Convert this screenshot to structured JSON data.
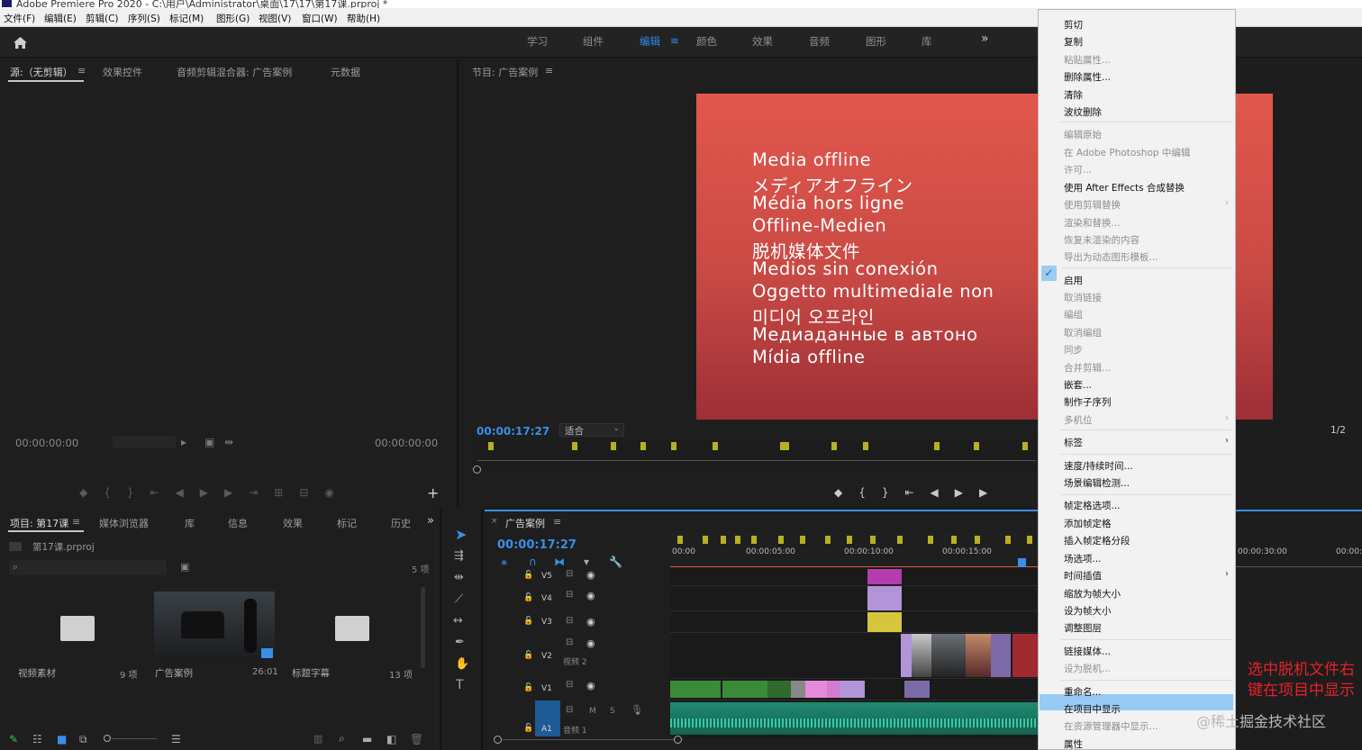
{
  "window": {
    "title": "Adobe Premiere Pro 2020 - C:\\用户\\Administrator\\桌面\\17\\17\\第17课.prproj *"
  },
  "menubar": [
    "文件(F)",
    "编辑(E)",
    "剪辑(C)",
    "序列(S)",
    "标记(M)",
    "图形(G)",
    "视图(V)",
    "窗口(W)",
    "帮助(H)"
  ],
  "workspaces": {
    "items": [
      "学习",
      "组件",
      "编辑",
      "颜色",
      "效果",
      "音频",
      "图形",
      "库"
    ],
    "active": "编辑",
    "more": "»"
  },
  "source_panel": {
    "tabs": [
      "源:（无剪辑）",
      "效果控件",
      "音频剪辑混合器: 广告案例",
      "元数据"
    ],
    "timecode_in": "00:00:00:00",
    "timecode_out": "00:00:00:00"
  },
  "program_panel": {
    "title": "节目: 广告案例",
    "timecode": "00:00:17:27",
    "fit": "适合",
    "resolution": "1/2",
    "offline_lines": [
      "Media offline",
      "メディアオフライン",
      "Média hors ligne",
      "Offline-Medien",
      "脱机媒体文件",
      "Medios sin conexión",
      "Oggetto multimediale non",
      "미디어 오프라인",
      "Медиаданные в автоно",
      "Mídia offline"
    ]
  },
  "project_panel": {
    "tabs": [
      "项目: 第17课",
      "媒体浏览器",
      "库",
      "信息",
      "效果",
      "标记",
      "历史"
    ],
    "file": "第17课.prproj",
    "count": "5 项",
    "bins": [
      {
        "name": "视频素材",
        "meta": "9 项"
      },
      {
        "name": "广告案例",
        "meta": "26:01"
      },
      {
        "name": "标题字幕",
        "meta": "13 项"
      }
    ]
  },
  "timeline": {
    "title": "广告案例",
    "timecode": "00:00:17:27",
    "ruler": [
      "00:00",
      "00:00:05:00",
      "00:00:10:00",
      "00:00:15:00",
      "00:00:30:00",
      "00:00:3"
    ],
    "tracks": [
      {
        "id": "V5",
        "label": ""
      },
      {
        "id": "V4",
        "label": ""
      },
      {
        "id": "V3",
        "label": ""
      },
      {
        "id": "V2",
        "label": "视频 2"
      },
      {
        "id": "V1",
        "label": ""
      },
      {
        "id": "A1",
        "label": "音频 1"
      }
    ],
    "audio_btns": [
      "M",
      "S"
    ]
  },
  "context_menu": {
    "items": [
      {
        "label": "剪切",
        "enabled": true
      },
      {
        "label": "复制",
        "enabled": true
      },
      {
        "label": "粘贴属性...",
        "enabled": false
      },
      {
        "label": "删除属性...",
        "enabled": true
      },
      {
        "label": "清除",
        "enabled": true
      },
      {
        "label": "波纹删除",
        "enabled": true
      },
      {
        "label": "编辑原始",
        "enabled": false
      },
      {
        "label": "在 Adobe Photoshop 中编辑",
        "enabled": false
      },
      {
        "label": "许可...",
        "enabled": false
      },
      {
        "label": "使用 After Effects 合成替换",
        "enabled": true
      },
      {
        "label": "使用剪辑替换",
        "enabled": false
      },
      {
        "label": "渲染和替换...",
        "enabled": false
      },
      {
        "label": "恢复未渲染的内容",
        "enabled": false
      },
      {
        "label": "导出为动态图形模板...",
        "enabled": false
      },
      {
        "label": "启用",
        "enabled": true
      },
      {
        "label": "取消链接",
        "enabled": false
      },
      {
        "label": "编组",
        "enabled": false
      },
      {
        "label": "取消编组",
        "enabled": false
      },
      {
        "label": "同步",
        "enabled": false
      },
      {
        "label": "合并剪辑...",
        "enabled": false
      },
      {
        "label": "嵌套...",
        "enabled": true
      },
      {
        "label": "制作子序列",
        "enabled": true
      },
      {
        "label": "多机位",
        "enabled": false
      },
      {
        "label": "标签",
        "enabled": true
      },
      {
        "label": "速度/持续时间...",
        "enabled": true
      },
      {
        "label": "场景编辑检测...",
        "enabled": true
      },
      {
        "label": "帧定格选项...",
        "enabled": true
      },
      {
        "label": "添加帧定格",
        "enabled": true
      },
      {
        "label": "插入帧定格分段",
        "enabled": true
      },
      {
        "label": "场选项...",
        "enabled": true
      },
      {
        "label": "时间插值",
        "enabled": true
      },
      {
        "label": "缩放为帧大小",
        "enabled": true
      },
      {
        "label": "设为帧大小",
        "enabled": true
      },
      {
        "label": "调整图层",
        "enabled": true
      },
      {
        "label": "链接媒体...",
        "enabled": true
      },
      {
        "label": "设为脱机...",
        "enabled": false
      },
      {
        "label": "重命名...",
        "enabled": true
      },
      {
        "label": "在项目中显示",
        "enabled": true
      },
      {
        "label": "在资源管理器中显示...",
        "enabled": false
      },
      {
        "label": "属性",
        "enabled": true
      }
    ],
    "highlighted": "在项目中显示",
    "checked": "启用"
  },
  "annotation": {
    "line1": "选中脱机文件右",
    "line2": "键在项目中显示"
  },
  "watermark": "@稀土掘金技术社区"
}
